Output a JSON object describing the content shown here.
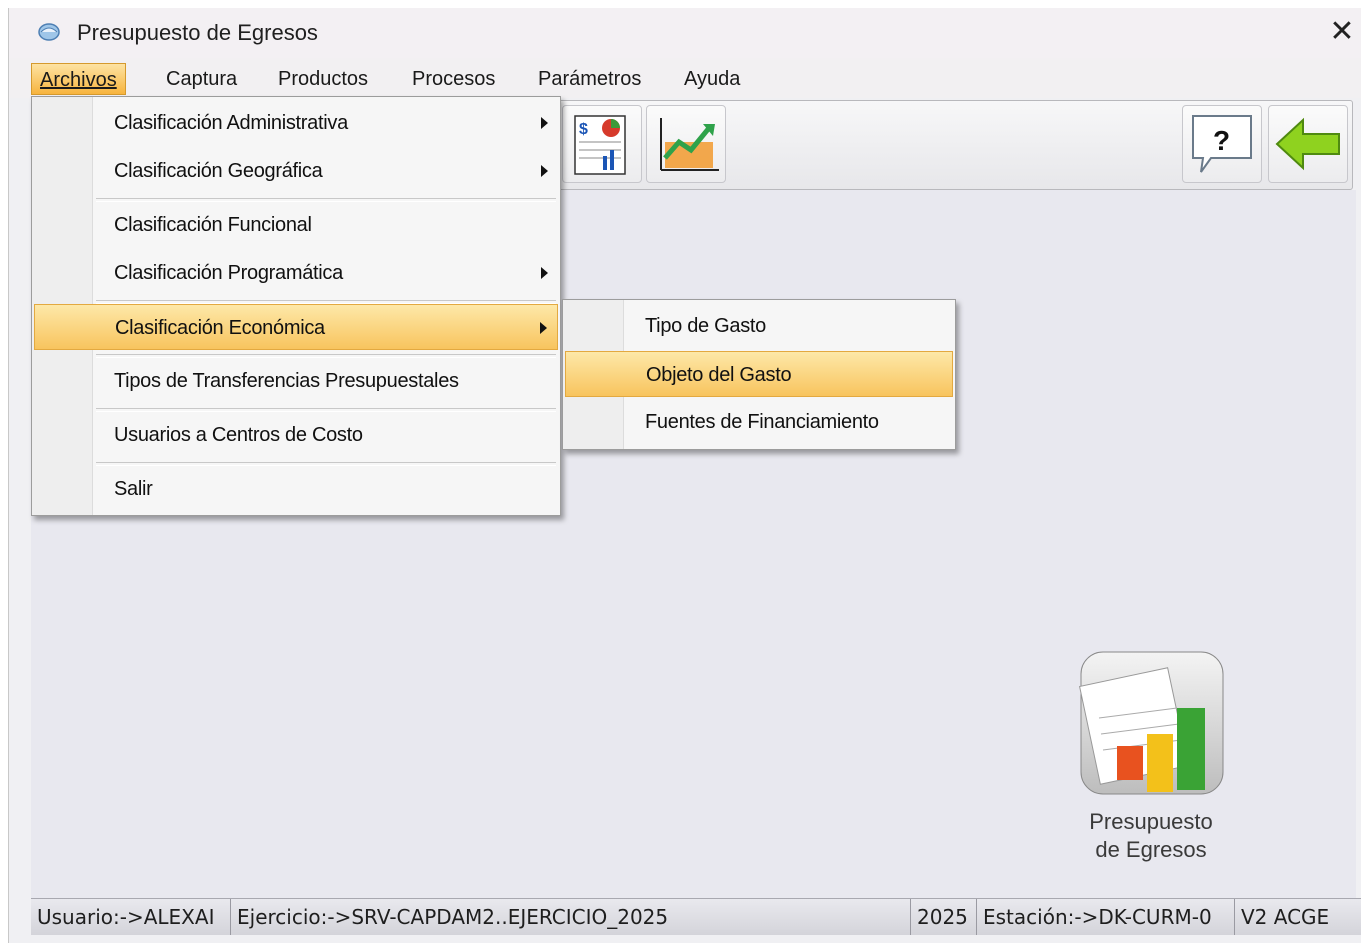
{
  "window": {
    "title": "Presupuesto de Egresos",
    "close_glyph": "✕"
  },
  "menubar": {
    "items": [
      {
        "label": "Archivos",
        "active": true
      },
      {
        "label": "Captura"
      },
      {
        "label": "Productos"
      },
      {
        "label": "Procesos"
      },
      {
        "label": "Parámetros"
      },
      {
        "label": "Ayuda"
      }
    ]
  },
  "toolbar": {
    "buttons": [
      {
        "icon": "budget-report-icon"
      },
      {
        "icon": "growth-chart-icon"
      },
      {
        "icon": "help-icon",
        "glyph": "?"
      },
      {
        "icon": "back-arrow-icon"
      }
    ]
  },
  "archivos_menu": {
    "items": [
      {
        "label": "Clasificación Administrativa",
        "submenu": true
      },
      {
        "label": "Clasificación Geográfica",
        "submenu": true
      },
      {
        "label": "Clasificación Funcional",
        "submenu": false
      },
      {
        "label": "Clasificación Programática",
        "submenu": true
      },
      {
        "label": "Clasificación Económica",
        "submenu": true,
        "highlighted": true
      },
      {
        "label": "Tipos de Transferencias Presupuestales",
        "submenu": false
      },
      {
        "label": "Usuarios a Centros de Costo",
        "submenu": false
      },
      {
        "label": "Salir",
        "submenu": false
      }
    ]
  },
  "economica_submenu": {
    "items": [
      {
        "label": "Tipo de Gasto"
      },
      {
        "label": "Objeto del Gasto",
        "highlighted": true
      },
      {
        "label": "Fuentes de Financiamiento"
      }
    ]
  },
  "desktop_shortcut": {
    "label_line1": "Presupuesto",
    "label_line2": "de Egresos"
  },
  "statusbar": {
    "usuario": "Usuario:->ALEXAI",
    "ejercicio": "Ejercicio:->SRV-CAPDAM2..EJERCICIO_2025",
    "year": "2025",
    "estacion": "Estación:->DK-CURM-0",
    "version": "V2 ACGE"
  },
  "colors": {
    "highlight_top": "#fde8a8",
    "highlight_bottom": "#f8c45e",
    "workspace": "#e8e8ef"
  }
}
